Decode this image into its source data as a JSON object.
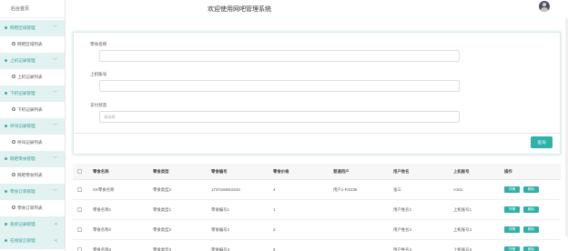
{
  "sidebar": {
    "home": "后台首页",
    "items": [
      {
        "type": "group",
        "label": "网吧区域管理",
        "chevron": "﹀"
      },
      {
        "type": "sub",
        "label": "网吧区域列表"
      },
      {
        "type": "group",
        "label": "上机记录管理",
        "chevron": "﹀"
      },
      {
        "type": "sub",
        "label": "上机记录列表"
      },
      {
        "type": "group",
        "label": "下机记录管理",
        "chevron": "﹀"
      },
      {
        "type": "sub",
        "label": "下机记录列表"
      },
      {
        "type": "group",
        "label": "呼叫记录管理",
        "chevron": "﹀"
      },
      {
        "type": "sub",
        "label": "呼叫记录列表"
      },
      {
        "type": "group",
        "label": "网吧零食管理",
        "chevron": "﹀"
      },
      {
        "type": "sub",
        "label": "网吧零食列表"
      },
      {
        "type": "group",
        "label": "零食订单管理",
        "chevron": "﹀"
      },
      {
        "type": "sub",
        "label": "零食订单列表"
      },
      {
        "type": "group",
        "label": "系统记录管理",
        "chevron": "<"
      },
      {
        "type": "group",
        "label": "在线留言管理",
        "chevron": "<"
      }
    ]
  },
  "header": {
    "title": "欢迎使用网吧管理系统",
    "avatar_icon": "user-avatar"
  },
  "search": {
    "fields": [
      {
        "label": "零食名称",
        "value": "",
        "placeholder": ""
      },
      {
        "label": "上机账号",
        "value": "",
        "placeholder": ""
      },
      {
        "label": "支付状态",
        "value": "",
        "placeholder": "请选择"
      }
    ],
    "button": "查询"
  },
  "table": {
    "headers": [
      "",
      "零食名称",
      "零食类型",
      "零食编号",
      "零食价格",
      "普通用户",
      "用户姓名",
      "上机账号",
      "操作"
    ],
    "rows": [
      [
        "",
        "XX零食名称",
        "零食类型2",
        "1737160810243",
        "4",
        "用户1-FI2235",
        "张三",
        "A101"
      ],
      [
        "",
        "零食名称1",
        "零食类型1",
        "零食编号1",
        "1",
        "",
        "用户姓名1",
        "上机账号1"
      ],
      [
        "",
        "零食名称2",
        "零食类型2",
        "零食编号2",
        "2",
        "",
        "用户姓名2",
        "上机账号2"
      ],
      [
        "",
        "零食名称3",
        "零食类型3",
        "零食编号3",
        "3",
        "",
        "用户姓名3",
        "上机账号3"
      ]
    ],
    "action_detail": "详情",
    "action_delete": "删除"
  },
  "colors": {
    "accent": "#2fb1a8",
    "sidebar_group_bg": "#e2f2f1",
    "sidebar_group_text": "#2f9e97"
  }
}
